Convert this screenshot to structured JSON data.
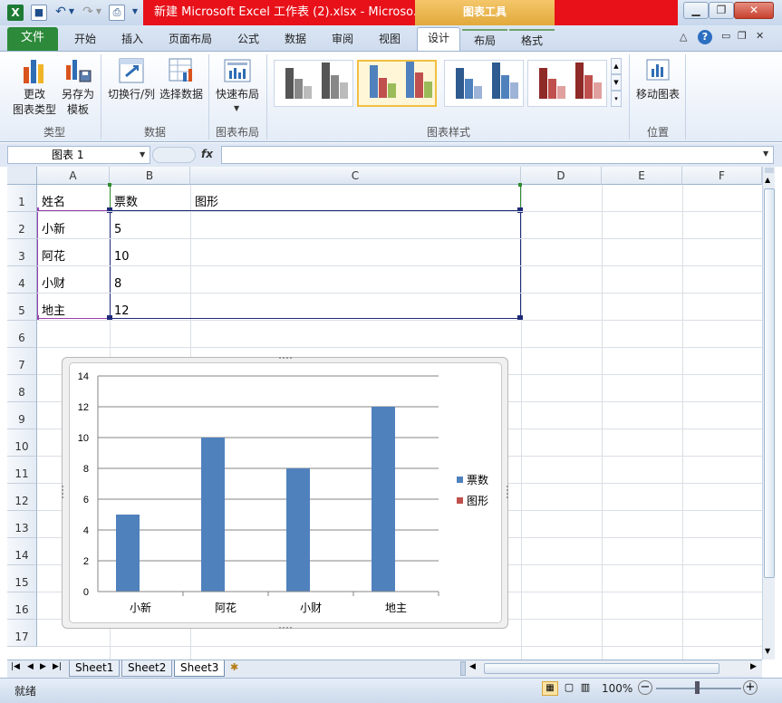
{
  "window": {
    "title": "新建 Microsoft Excel 工作表 (2).xlsx - Microso...",
    "context_tools": "图表工具",
    "minimize_icon": "minimize-icon",
    "restore_icon": "restore-icon",
    "close_icon": "close-icon"
  },
  "ribbon_tabs": {
    "file": "文件",
    "home": "开始",
    "insert": "插入",
    "page_layout": "页面布局",
    "formulas": "公式",
    "data": "数据",
    "review": "审阅",
    "view": "视图",
    "design": "设计",
    "layout": "布局",
    "format": "格式"
  },
  "ribbon": {
    "change_type_l1": "更改",
    "change_type_l2": "图表类型",
    "save_template_l1": "另存为",
    "save_template_l2": "模板",
    "switch_rowcol": "切换行/列",
    "select_data": "选择数据",
    "quick_layout": "快速布局",
    "move_chart": "移动图表",
    "group_type": "类型",
    "group_data": "数据",
    "group_layout": "图表布局",
    "group_styles": "图表样式",
    "group_location": "位置"
  },
  "formula_bar": {
    "name_box": "图表 1",
    "fx": "fx",
    "content": ""
  },
  "grid": {
    "columns": [
      "A",
      "B",
      "C",
      "D",
      "E",
      "F"
    ],
    "rows": [
      "1",
      "2",
      "3",
      "4",
      "5",
      "6",
      "7",
      "8",
      "9",
      "10",
      "11",
      "12",
      "13",
      "14",
      "15",
      "16",
      "17"
    ],
    "cells": {
      "A1": "姓名",
      "B1": "票数",
      "C1": "图形",
      "A2": "小新",
      "B2": "5",
      "A3": "阿花",
      "B3": "10",
      "A4": "小财",
      "B4": "8",
      "A5": "地主",
      "B5": "12"
    }
  },
  "chart_data": {
    "type": "bar",
    "categories": [
      "小新",
      "阿花",
      "小财",
      "地主"
    ],
    "series": [
      {
        "name": "票数",
        "values": [
          5,
          10,
          8,
          12
        ],
        "color": "#4f81bd"
      },
      {
        "name": "图形",
        "values": [],
        "color": "#c0504d"
      }
    ],
    "y_ticks": [
      "0",
      "2",
      "4",
      "6",
      "8",
      "10",
      "12",
      "14"
    ],
    "ylim": [
      0,
      14
    ],
    "grid": true,
    "legend_position": "right"
  },
  "sheets": {
    "tabs": [
      "Sheet1",
      "Sheet2",
      "Sheet3"
    ],
    "active": "Sheet3"
  },
  "status": {
    "ready": "就绪",
    "zoom": "100%"
  }
}
